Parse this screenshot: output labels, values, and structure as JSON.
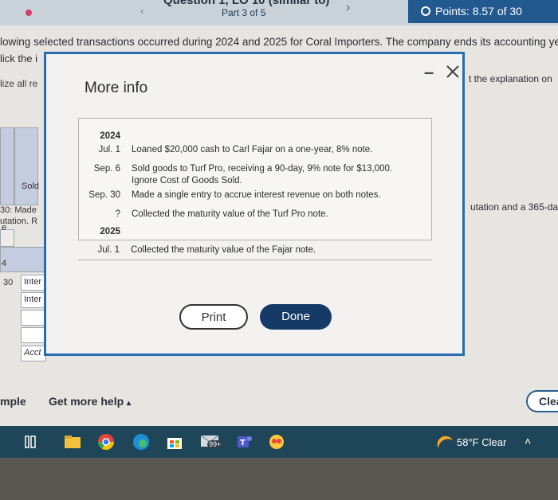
{
  "header": {
    "title_fragment": "Question 1, LO 10 (similar to)",
    "part": "Part 3 of 5",
    "points": "Points: 8.57 of 30"
  },
  "question": {
    "text": "lowing selected transactions occurred during 2024 and 2025 for Coral Importers. The company ends its accounting year on Septemb",
    "click_text": "lick the i",
    "utilize_text": "lize all re",
    "explanation_fragment": "t the explanation on",
    "computation_fragment": "utation and a 365-da",
    "table_fragments": [
      "Sold",
      "30: Made",
      "utation. R",
      "e",
      "4",
      "30",
      "Inter",
      "Inter",
      "Acct"
    ]
  },
  "modal": {
    "title": "More info",
    "rows": [
      {
        "date": "2024",
        "desc": "",
        "year": true
      },
      {
        "date": "Jul. 1",
        "desc": "Loaned $20,000 cash to Carl Fajar on a one-year, 8% note."
      },
      {
        "date": "Sep. 6",
        "desc": "Sold goods to Turf Pro, receiving a 90-day, 9% note for $13,000."
      },
      {
        "date": "",
        "desc": "Ignore Cost of Goods Sold."
      },
      {
        "date": "Sep. 30",
        "desc": "Made a single entry to accrue interest revenue on both notes."
      },
      {
        "date": "?",
        "desc": "Collected the maturity value of the Turf Pro note."
      },
      {
        "date": "2025",
        "desc": "",
        "year": true
      },
      {
        "date": "Jul. 1",
        "desc": "Collected the maturity value of the Fajar note."
      }
    ],
    "print_label": "Print",
    "done_label": "Done"
  },
  "footer": {
    "sample_label": "mple",
    "help_label": "Get more help",
    "clear_label": "Clea"
  },
  "taskbar": {
    "mail_badge": "99+",
    "weather": "58°F  Clear"
  },
  "colors": {
    "accent": "#2a6cb0",
    "done_button": "#153a66",
    "points_bar": "#22598f",
    "taskbar": "#1f4658"
  }
}
